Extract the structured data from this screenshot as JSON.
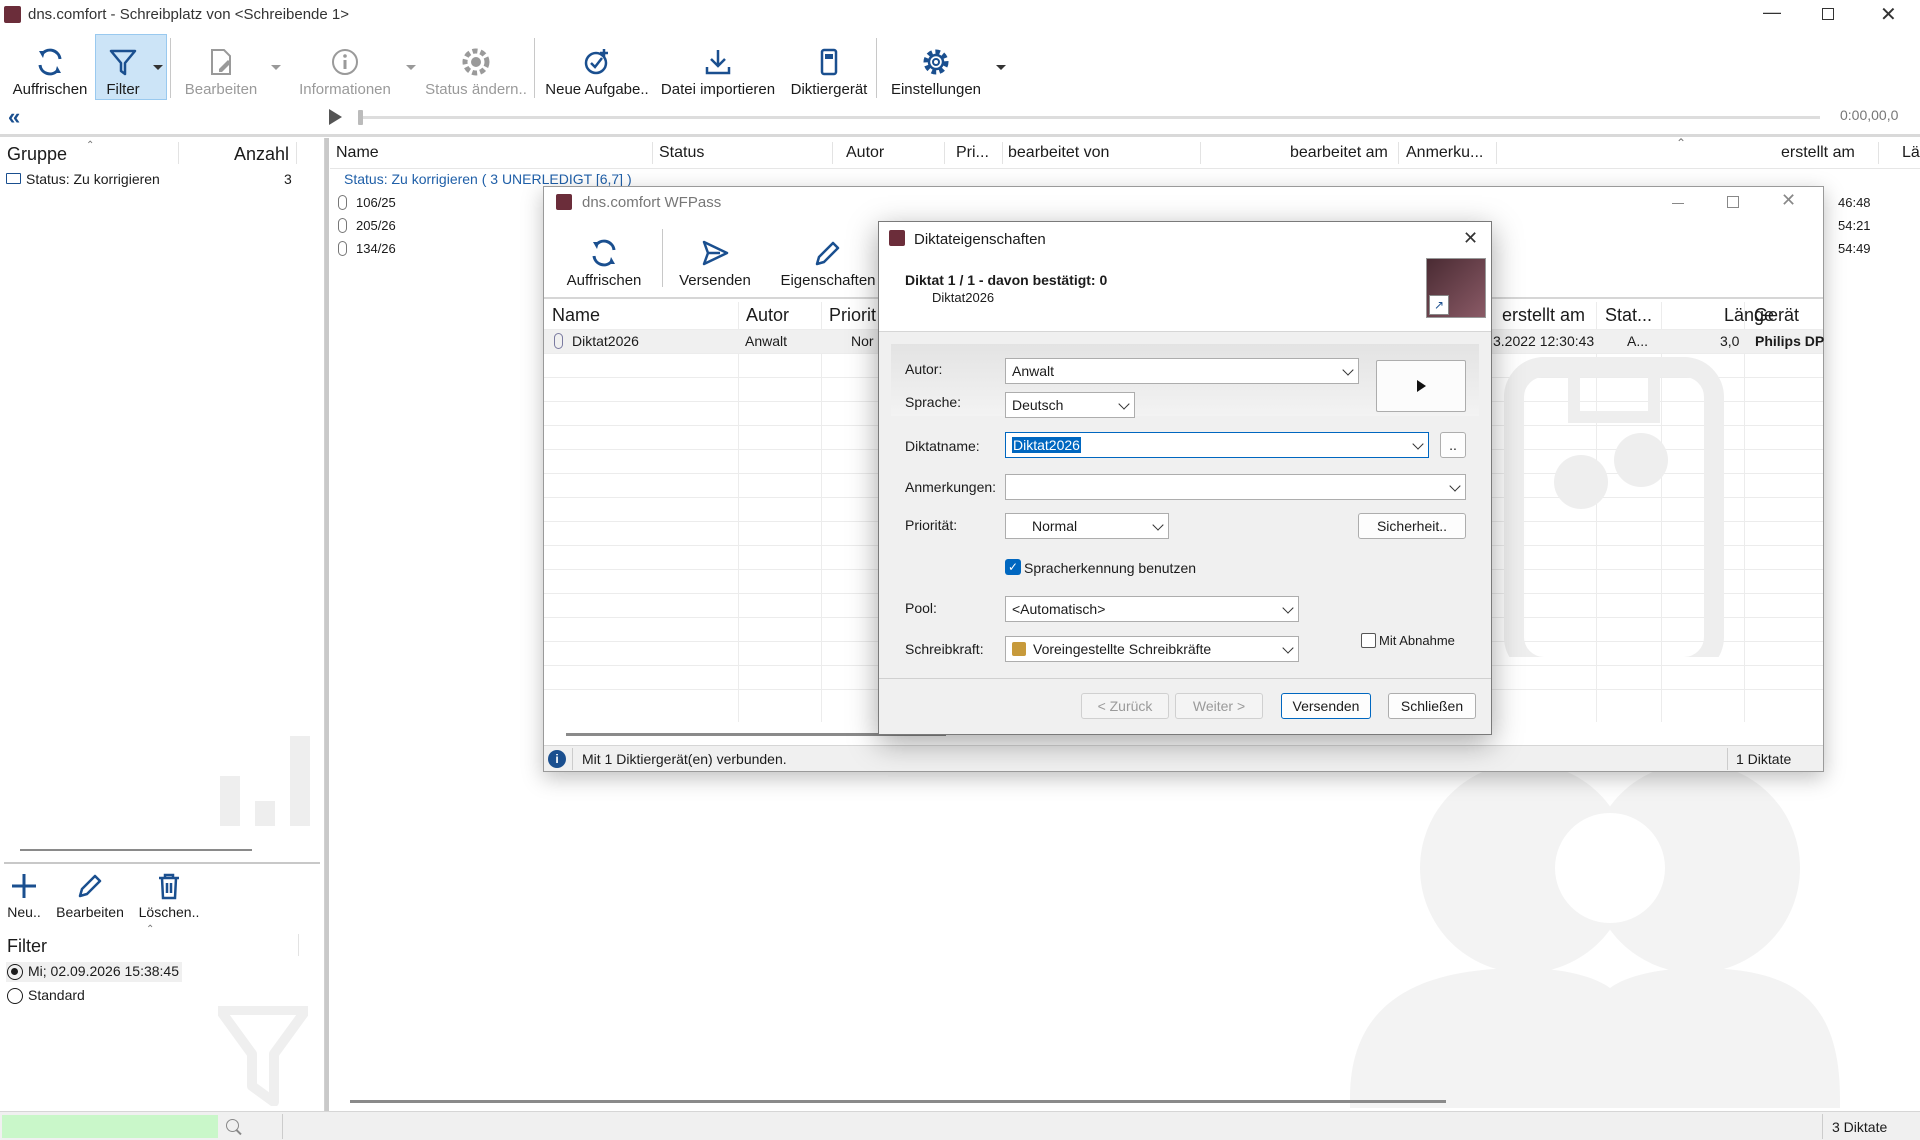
{
  "app": {
    "title": "dns.comfort - Schreibplatz von <Schreibende 1>"
  },
  "toolbar": {
    "refresh": "Auffrischen",
    "filter": "Filter",
    "edit": "Bearbeiten",
    "info": "Informationen",
    "status_change": "Status ändern..",
    "new_task": "Neue Aufgabe..",
    "import_file": "Datei importieren",
    "dictation_device": "Diktiergerät",
    "settings": "Einstellungen"
  },
  "player": {
    "time": "0:00,00,0"
  },
  "left_panel": {
    "col_group": "Gruppe",
    "col_count": "Anzahl",
    "groups": [
      {
        "label": "Status: Zu korrigieren",
        "count": "3"
      }
    ],
    "actions": {
      "new": "Neu..",
      "edit": "Bearbeiten",
      "delete": "Löschen.."
    },
    "filter_header": "Filter",
    "filters": [
      {
        "label": "Mi; 02.09.2026 15:38:45",
        "selected": true
      },
      {
        "label": "Standard",
        "selected": false
      }
    ]
  },
  "main_table": {
    "columns": [
      "Name",
      "Status",
      "Autor",
      "Pri...",
      "bearbeitet von",
      "bearbeitet am",
      "Anmerku...",
      "erstellt am",
      "Län"
    ],
    "group_header": "Status: Zu korrigieren ( 3 UNERLEDIGT [6,7] )",
    "rows": [
      {
        "name": "106/25",
        "created": "46:48"
      },
      {
        "name": "205/26",
        "created": "54:21"
      },
      {
        "name": "134/26",
        "created": "54:49"
      }
    ]
  },
  "wfpass": {
    "title": "dns.comfort WFPass",
    "toolbar": {
      "refresh": "Auffrischen",
      "send": "Versenden",
      "properties": "Eigenschaften"
    },
    "columns": [
      "Name",
      "Autor",
      "Priorit",
      "erstellt am",
      "Stat...",
      "Länge",
      "Gerät"
    ],
    "rows": [
      {
        "name": "Diktat2026",
        "author": "Anwalt",
        "priority": "Nor",
        "created": "3.2022 12:30:43",
        "status": "A...",
        "length": "3,0",
        "device": "Philips DP"
      }
    ],
    "status_text": "Mit 1 Diktiergerät(en) verbunden.",
    "count_text": "1 Diktate"
  },
  "dialog": {
    "title": "Diktateigenschaften",
    "header_main": "Diktat 1 / 1 - davon bestätigt: 0",
    "header_sub": "Diktat2026",
    "labels": {
      "author": "Autor:",
      "language": "Sprache:",
      "name": "Diktatname:",
      "notes": "Anmerkungen:",
      "priority": "Priorität:",
      "pool": "Pool:",
      "typist": "Schreibkraft:"
    },
    "values": {
      "author": "Anwalt",
      "language": "Deutsch",
      "name": "Diktat2026",
      "notes": "",
      "priority": "Normal",
      "pool": "<Automatisch>",
      "typist": "Voreingestellte Schreibkräfte"
    },
    "browse": "..",
    "security": "Sicherheit..",
    "speech_recognition": "Spracherkennung benutzen",
    "speech_recognition_checked": true,
    "with_acceptance": "Mit Abnahme",
    "with_acceptance_checked": false,
    "buttons": {
      "back": "< Zurück",
      "next": "Weiter >",
      "send": "Versenden",
      "close": "Schließen"
    }
  },
  "statusbar": {
    "count": "3 Diktate"
  },
  "colors": {
    "accent": "#0067c0",
    "filter_active_bg": "#cce4f7",
    "search_bg": "#c9f7c9",
    "group_header_text": "#1f5fa8"
  }
}
